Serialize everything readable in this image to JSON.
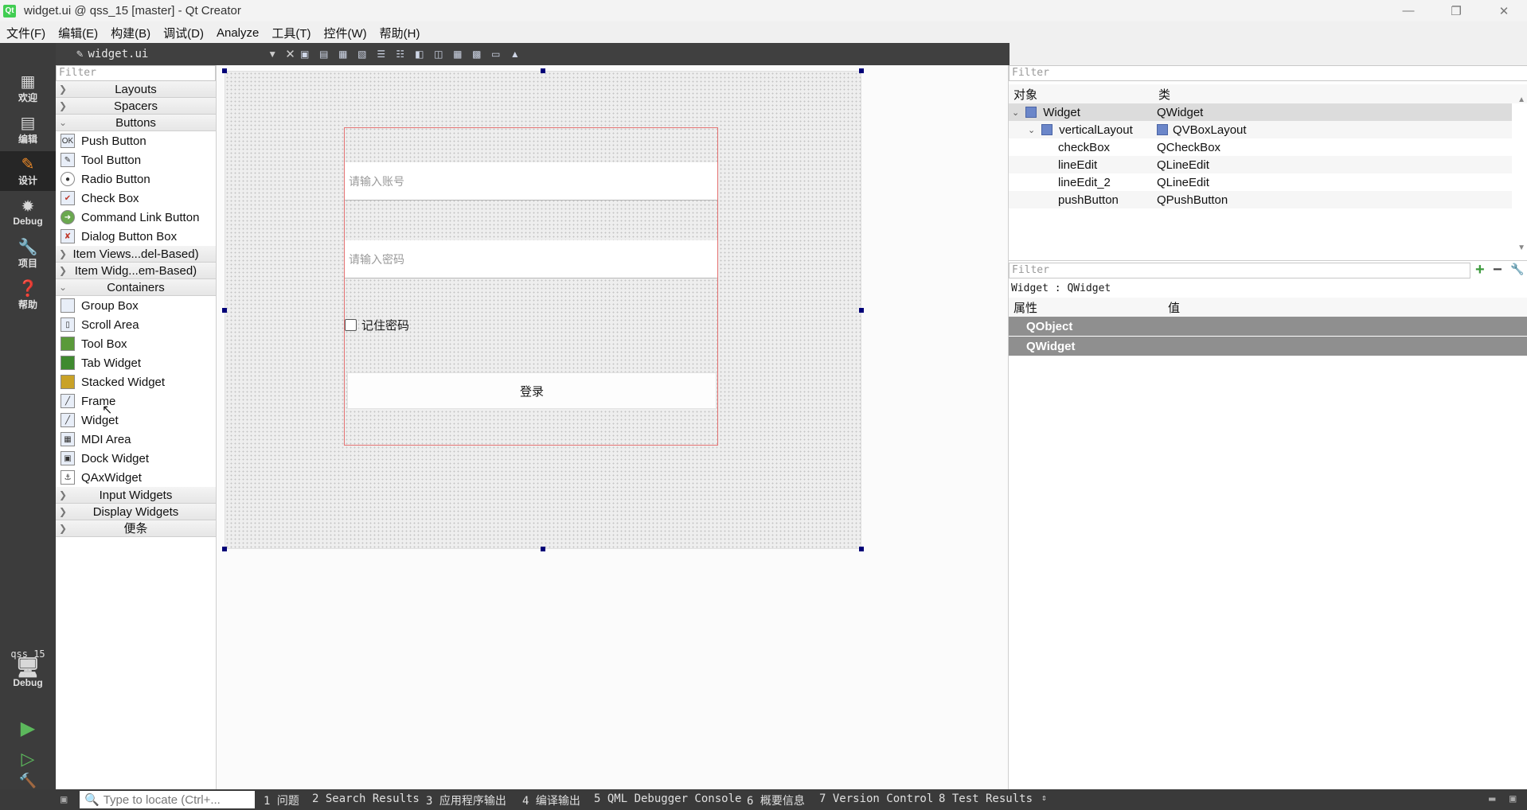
{
  "window": {
    "title": "widget.ui @ qss_15 [master] - Qt Creator"
  },
  "menubar": [
    "文件(F)",
    "编辑(E)",
    "构建(B)",
    "调试(D)",
    "Analyze",
    "工具(T)",
    "控件(W)",
    "帮助(H)"
  ],
  "modes": [
    {
      "label": "欢迎",
      "icon": "grid-icon"
    },
    {
      "label": "编辑",
      "icon": "document-icon"
    },
    {
      "label": "设计",
      "icon": "pencil-icon",
      "active": true
    },
    {
      "label": "Debug",
      "icon": "bug-icon"
    },
    {
      "label": "项目",
      "icon": "wrench-icon"
    },
    {
      "label": "帮助",
      "icon": "help-icon"
    }
  ],
  "kit": {
    "project": "qss_15",
    "build": "Debug"
  },
  "editor": {
    "file": "widget.ui"
  },
  "widgetbox": {
    "filter_placeholder": "Filter",
    "categories_top": [
      "Layouts",
      "Spacers",
      "Buttons"
    ],
    "buttons": [
      "Push Button",
      "Tool Button",
      "Radio Button",
      "Check Box",
      "Command Link Button",
      "Dialog Button Box"
    ],
    "categories_mid": [
      "Item Views...del-Based)",
      "Item Widg...em-Based)",
      "Containers"
    ],
    "containers": [
      "Group Box",
      "Scroll Area",
      "Tool Box",
      "Tab Widget",
      "Stacked Widget",
      "Frame",
      "Widget",
      "MDI Area",
      "Dock Widget",
      "QAxWidget"
    ],
    "categories_bottom": [
      "Input Widgets",
      "Display Widgets",
      "便条"
    ]
  },
  "form": {
    "account_placeholder": "请输入账号",
    "password_placeholder": "请输入密码",
    "remember_label": "记住密码",
    "login_label": "登录"
  },
  "object_inspector": {
    "filter_placeholder": "Filter",
    "col_object": "对象",
    "col_class": "类",
    "rows": [
      {
        "name": "Widget",
        "cls": "QWidget"
      },
      {
        "name": "verticalLayout",
        "cls": "QVBoxLayout"
      },
      {
        "name": "checkBox",
        "cls": "QCheckBox"
      },
      {
        "name": "lineEdit",
        "cls": "QLineEdit"
      },
      {
        "name": "lineEdit_2",
        "cls": "QLineEdit"
      },
      {
        "name": "pushButton",
        "cls": "QPushButton"
      }
    ]
  },
  "property_editor": {
    "filter_placeholder": "Filter",
    "context": "Widget : QWidget",
    "col_property": "属性",
    "col_value": "值",
    "groups": [
      "QObject",
      "QWidget"
    ]
  },
  "statusbar": {
    "locate_placeholder": "Type to locate (Ctrl+...",
    "panes": [
      "1 问题",
      "2 Search Results",
      "3 应用程序输出",
      "4 编译输出",
      "5 QML Debugger Console",
      "6 概要信息",
      "7 Version Control",
      "8 Test Results"
    ]
  }
}
